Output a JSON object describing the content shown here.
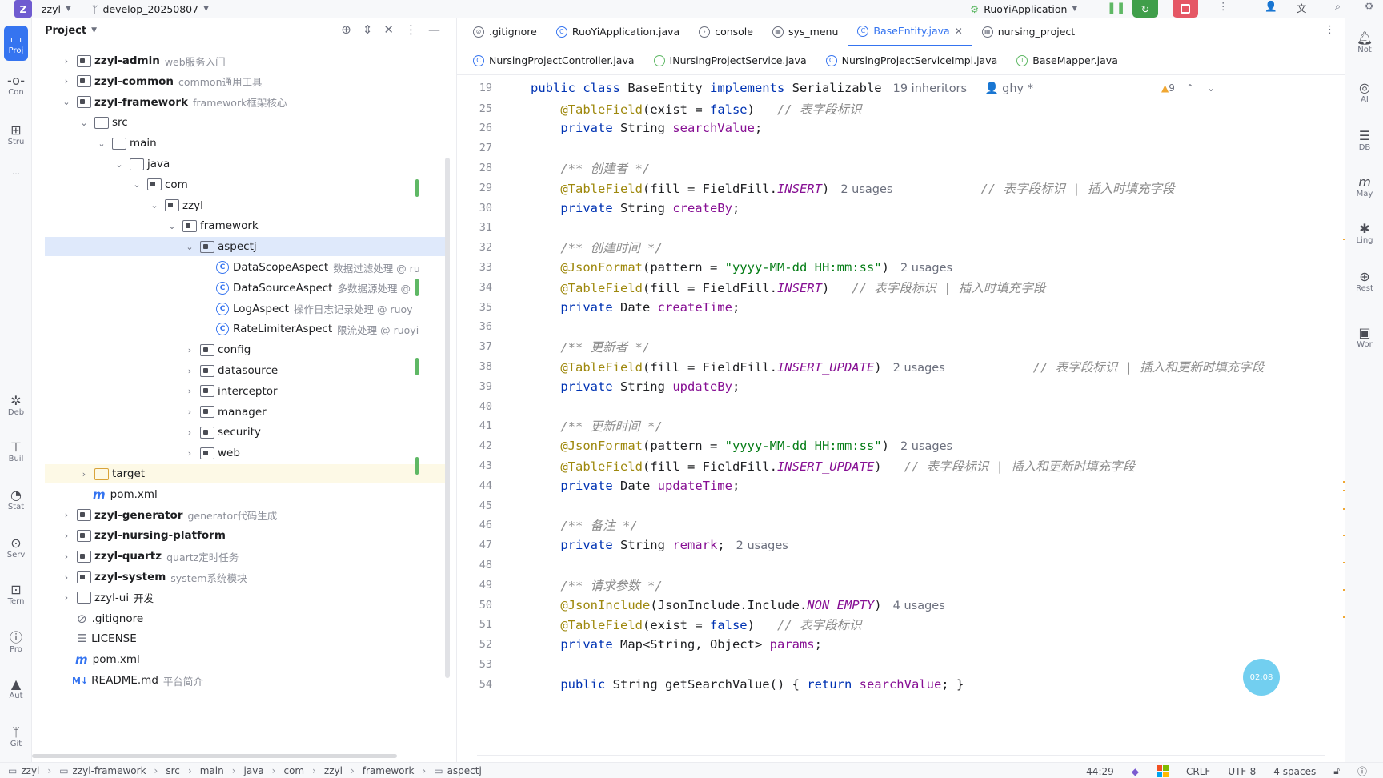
{
  "titlebar": {
    "logo": "Z",
    "project": "zzyl",
    "branch": "develop_20250807",
    "run_config": "RuoYiApplication"
  },
  "left_strip": [
    {
      "name": "project",
      "label": "Proj"
    },
    {
      "name": "commit",
      "label": "Con"
    },
    {
      "name": "structure",
      "label": "Stru"
    },
    {
      "name": "more",
      "label": "…"
    },
    {
      "name": "debug",
      "label": "Deb"
    },
    {
      "name": "build",
      "label": "Buil"
    },
    {
      "name": "statistic",
      "label": "Stat"
    },
    {
      "name": "services",
      "label": "Serv"
    },
    {
      "name": "terminal",
      "label": "Tern"
    },
    {
      "name": "problems",
      "label": "Pro"
    },
    {
      "name": "auto",
      "label": "Aut"
    },
    {
      "name": "git",
      "label": "Git"
    }
  ],
  "project_panel": {
    "title": "Project",
    "tree": [
      {
        "label": "zzyl-admin",
        "hint": "web服务入门",
        "bold": true,
        "arrow": "›",
        "icon": "module"
      },
      {
        "label": "zzyl-common",
        "hint": "common通用工具",
        "bold": true,
        "arrow": "›",
        "icon": "module"
      },
      {
        "label": "zzyl-framework",
        "hint": "framework框架核心",
        "bold": true,
        "arrow": "⌄",
        "icon": "module"
      },
      {
        "label": "src",
        "arrow": "⌄",
        "icon": "folder"
      },
      {
        "label": "main",
        "arrow": "⌄",
        "icon": "folder"
      },
      {
        "label": "java",
        "arrow": "⌄",
        "icon": "folder"
      },
      {
        "label": "com",
        "arrow": "⌄",
        "icon": "package"
      },
      {
        "label": "zzyl",
        "arrow": "⌄",
        "icon": "package"
      },
      {
        "label": "framework",
        "arrow": "⌄",
        "icon": "package"
      },
      {
        "label": "aspectj",
        "arrow": "⌄",
        "icon": "package",
        "selected": true
      },
      {
        "label": "DataScopeAspect",
        "hint": "数据过滤处理 @ ru",
        "icon": "class"
      },
      {
        "label": "DataSourceAspect",
        "hint": "多数据源处理 @ r",
        "icon": "class"
      },
      {
        "label": "LogAspect",
        "hint": "操作日志记录处理 @ ruoy",
        "icon": "class"
      },
      {
        "label": "RateLimiterAspect",
        "hint": "限流处理 @ ruoyi",
        "icon": "class"
      },
      {
        "label": "config",
        "arrow": "›",
        "icon": "package"
      },
      {
        "label": "datasource",
        "arrow": "›",
        "icon": "package"
      },
      {
        "label": "interceptor",
        "arrow": "›",
        "icon": "package"
      },
      {
        "label": "manager",
        "arrow": "›",
        "icon": "package"
      },
      {
        "label": "security",
        "arrow": "›",
        "icon": "package"
      },
      {
        "label": "web",
        "arrow": "›",
        "icon": "package"
      },
      {
        "label": "target",
        "arrow": "›",
        "icon": "folder-yellow",
        "yellow": true
      },
      {
        "label": "pom.xml",
        "icon": "maven"
      },
      {
        "label": "zzyl-generator",
        "hint": "generator代码生成",
        "bold": true,
        "arrow": "›",
        "icon": "module"
      },
      {
        "label": "zzyl-nursing-platform",
        "bold": true,
        "arrow": "›",
        "icon": "module"
      },
      {
        "label": "zzyl-quartz",
        "hint": "quartz定时任务",
        "bold": true,
        "arrow": "›",
        "icon": "module"
      },
      {
        "label": "zzyl-system",
        "hint": "system系统模块",
        "bold": true,
        "arrow": "›",
        "icon": "module"
      },
      {
        "label": "zzyl-ui",
        "hint": "",
        "extra": "开发",
        "arrow": "›",
        "icon": "folder"
      },
      {
        "label": ".gitignore",
        "icon": "ignore"
      },
      {
        "label": "LICENSE",
        "icon": "text"
      },
      {
        "label": "pom.xml",
        "icon": "maven"
      },
      {
        "label": "README.md",
        "hint": "平台简介",
        "icon": "markdown"
      }
    ]
  },
  "tabs_row1": [
    {
      "label": ".gitignore",
      "icon": "ignore"
    },
    {
      "label": "RuoYiApplication.java",
      "icon": "app"
    },
    {
      "label": "console",
      "icon": "console"
    },
    {
      "label": "sys_menu",
      "icon": "table"
    },
    {
      "label": "BaseEntity.java",
      "icon": "class",
      "active": true
    },
    {
      "label": "nursing_project",
      "icon": "table"
    }
  ],
  "tabs_row2": [
    {
      "label": "NursingProjectController.java",
      "icon": "class"
    },
    {
      "label": "INursingProjectService.java",
      "icon": "interface"
    },
    {
      "label": "NursingProjectServiceImpl.java",
      "icon": "class"
    },
    {
      "label": "BaseMapper.java",
      "icon": "interface"
    }
  ],
  "editor": {
    "header_line": {
      "num": "19",
      "inheritors": "19 inheritors",
      "author": "ghy *",
      "warnings": "9"
    },
    "lines": [
      {
        "num": "25",
        "tokens": [
          [
            "ann",
            "    @TableField"
          ],
          [
            "",
            "("
          ],
          [
            "",
            "exist = "
          ],
          [
            "kw",
            "false"
          ],
          [
            "",
            ")"
          ],
          [
            "cmt",
            "   // 表字段标识"
          ]
        ]
      },
      {
        "num": "26",
        "tokens": [
          [
            "kw",
            "    private "
          ],
          [
            "",
            "String "
          ],
          [
            "fld",
            "searchValue"
          ],
          [
            "",
            ";"
          ]
        ]
      },
      {
        "num": "27",
        "tokens": []
      },
      {
        "num": "28",
        "tokens": [
          [
            "cmt",
            "    /** 创建者 */"
          ]
        ]
      },
      {
        "num": "29",
        "tokens": [
          [
            "ann",
            "    @TableField"
          ],
          [
            "",
            "(fill = FieldFill."
          ],
          [
            "enm",
            "INSERT"
          ],
          [
            "",
            ")"
          ]
        ],
        "usages": "2 usages",
        "comment2": "// 表字段标识 | 插入时填充字段",
        "changed": true
      },
      {
        "num": "30",
        "tokens": [
          [
            "kw",
            "    private "
          ],
          [
            "",
            "String "
          ],
          [
            "fld",
            "createBy"
          ],
          [
            "",
            ";"
          ]
        ]
      },
      {
        "num": "31",
        "tokens": []
      },
      {
        "num": "32",
        "tokens": [
          [
            "cmt",
            "    /** 创建时间 */"
          ]
        ]
      },
      {
        "num": "33",
        "tokens": [
          [
            "ann",
            "    @JsonFormat"
          ],
          [
            "",
            "(pattern = "
          ],
          [
            "str",
            "\"yyyy-MM-dd HH:mm:ss\""
          ],
          [
            "",
            ")"
          ]
        ],
        "usages": "2 usages"
      },
      {
        "num": "34",
        "tokens": [
          [
            "ann",
            "    @TableField"
          ],
          [
            "",
            "(fill = FieldFill."
          ],
          [
            "enm",
            "INSERT"
          ],
          [
            "",
            ")"
          ],
          [
            "cmt",
            "   // 表字段标识 | 插入时填充字段"
          ]
        ],
        "changed": true
      },
      {
        "num": "35",
        "tokens": [
          [
            "kw",
            "    private "
          ],
          [
            "",
            "Date "
          ],
          [
            "fld",
            "createTime"
          ],
          [
            "",
            ";"
          ]
        ]
      },
      {
        "num": "36",
        "tokens": []
      },
      {
        "num": "37",
        "tokens": [
          [
            "cmt",
            "    /** 更新者 */"
          ]
        ]
      },
      {
        "num": "38",
        "tokens": [
          [
            "ann",
            "    @TableField"
          ],
          [
            "",
            "(fill = FieldFill."
          ],
          [
            "enm",
            "INSERT_UPDATE"
          ],
          [
            "",
            ")"
          ]
        ],
        "usages": "2 usages",
        "comment2": "// 表字段标识 | 插入和更新时填充字段",
        "changed": true
      },
      {
        "num": "39",
        "tokens": [
          [
            "kw",
            "    private "
          ],
          [
            "",
            "String "
          ],
          [
            "fld",
            "updateBy"
          ],
          [
            "",
            ";"
          ]
        ]
      },
      {
        "num": "40",
        "tokens": []
      },
      {
        "num": "41",
        "tokens": [
          [
            "cmt",
            "    /** 更新时间 */"
          ]
        ]
      },
      {
        "num": "42",
        "tokens": [
          [
            "ann",
            "    @JsonFormat"
          ],
          [
            "",
            "(pattern = "
          ],
          [
            "str",
            "\"yyyy-MM-dd HH:mm:ss\""
          ],
          [
            "",
            ")"
          ]
        ],
        "usages": "2 usages"
      },
      {
        "num": "43",
        "tokens": [
          [
            "ann",
            "    @TableField"
          ],
          [
            "",
            "(fill = FieldFill."
          ],
          [
            "enm",
            "INSERT_UPDATE"
          ],
          [
            "",
            ")"
          ],
          [
            "cmt",
            "   // 表字段标识 | 插入和更新时填充字段"
          ]
        ],
        "changed": true
      },
      {
        "num": "44",
        "tokens": [
          [
            "kw",
            "    private "
          ],
          [
            "",
            "Date "
          ],
          [
            "fld",
            "updateTime"
          ],
          [
            "",
            ";"
          ]
        ]
      },
      {
        "num": "45",
        "tokens": []
      },
      {
        "num": "46",
        "tokens": [
          [
            "cmt",
            "    /** 备注 */"
          ]
        ]
      },
      {
        "num": "47",
        "tokens": [
          [
            "kw",
            "    private "
          ],
          [
            "",
            "String "
          ],
          [
            "fld",
            "remark"
          ],
          [
            "",
            ";"
          ]
        ],
        "usages": "2 usages"
      },
      {
        "num": "48",
        "tokens": []
      },
      {
        "num": "49",
        "tokens": [
          [
            "cmt",
            "    /** 请求参数 */"
          ]
        ]
      },
      {
        "num": "50",
        "tokens": [
          [
            "ann",
            "    @JsonInclude"
          ],
          [
            "",
            "(JsonInclude.Include."
          ],
          [
            "enm",
            "NON_EMPTY"
          ],
          [
            "",
            ")"
          ]
        ],
        "usages": "4 usages"
      },
      {
        "num": "51",
        "tokens": [
          [
            "ann",
            "    @TableField"
          ],
          [
            "",
            "("
          ],
          [
            "",
            "exist = "
          ],
          [
            "kw",
            "false"
          ],
          [
            "",
            ")"
          ],
          [
            "cmt",
            "   // 表字段标识"
          ]
        ]
      },
      {
        "num": "52",
        "tokens": [
          [
            "kw",
            "    private "
          ],
          [
            "",
            "Map<String, Object> "
          ],
          [
            "fld",
            "params"
          ],
          [
            "",
            ";"
          ]
        ]
      },
      {
        "num": "53",
        "tokens": []
      },
      {
        "num": "54",
        "tokens": [
          [
            "kw",
            "    public "
          ],
          [
            "",
            "String "
          ],
          [
            "",
            "getSearchValue() { "
          ],
          [
            "kw",
            "return "
          ],
          [
            "fld",
            "searchValue"
          ],
          [
            "",
            "; }"
          ]
        ]
      }
    ]
  },
  "right_strip": [
    {
      "name": "notifications",
      "label": "Not"
    },
    {
      "name": "ai",
      "label": "AI"
    },
    {
      "name": "database",
      "label": "DB"
    },
    {
      "name": "maven",
      "label": "May"
    },
    {
      "name": "lingma",
      "label": "Ling"
    },
    {
      "name": "rest",
      "label": "Rest"
    },
    {
      "name": "word",
      "label": "Wor"
    }
  ],
  "bubble": "02:08",
  "statusbar": {
    "crumbs": [
      "zzyl",
      "zzyl-framework",
      "src",
      "main",
      "java",
      "com",
      "zzyl",
      "framework",
      "aspectj"
    ],
    "position": "44:29",
    "line_sep": "CRLF",
    "encoding": "UTF-8",
    "indent": "4 spaces"
  },
  "colors": {
    "accent": "#3574f0",
    "selection": "#dfe9fb",
    "changed": "#5fb865",
    "warning": "#f0a732"
  }
}
